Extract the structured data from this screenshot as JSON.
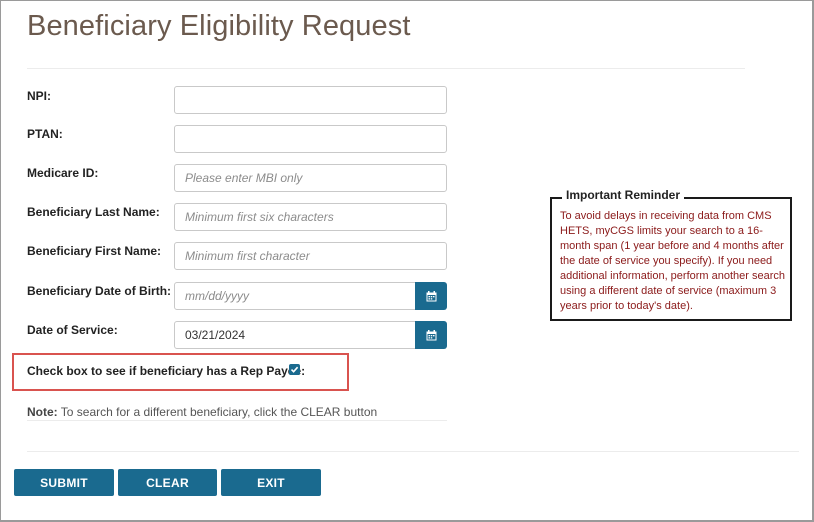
{
  "page": {
    "title": "Beneficiary Eligibility Request"
  },
  "form": {
    "fields": [
      {
        "label": "NPI:",
        "value": "",
        "placeholder": ""
      },
      {
        "label": "PTAN:",
        "value": "",
        "placeholder": ""
      },
      {
        "label": "Medicare ID:",
        "value": "",
        "placeholder": "Please enter MBI only"
      },
      {
        "label": "Beneficiary Last Name:",
        "value": "",
        "placeholder": "Minimum first six characters"
      },
      {
        "label": "Beneficiary First Name:",
        "value": "",
        "placeholder": "Minimum first character"
      },
      {
        "label": "Beneficiary Date of Birth:",
        "value": "",
        "placeholder": "mm/dd/yyyy"
      },
      {
        "label": "Date of Service:",
        "value": "03/21/2024",
        "placeholder": ""
      }
    ],
    "rep_payee_label": "Check box to see if beneficiary has a Rep Payee:",
    "rep_payee_checked": true,
    "note_prefix": "Note:",
    "note_text": " To search for a different beneficiary, click the CLEAR button"
  },
  "reminder": {
    "title": "Important Reminder",
    "body": "To avoid delays in receiving data from CMS HETS, myCGS limits your search to a 16-month span (1 year before and 4 months after the date of service you specify). If you need additional information, perform another search using a different date of service (maximum 3 years prior to today's date)."
  },
  "buttons": {
    "submit": "SUBMIT",
    "clear": "CLEAR",
    "exit": "EXIT"
  },
  "colors": {
    "title": "#6b5a4e",
    "primary": "#1a6a8f",
    "reminder_text": "#8b1a1a",
    "highlight_border": "#d9534f"
  },
  "icons": {
    "calendar": "calendar-icon",
    "checkbox": "checkmark-icon"
  }
}
